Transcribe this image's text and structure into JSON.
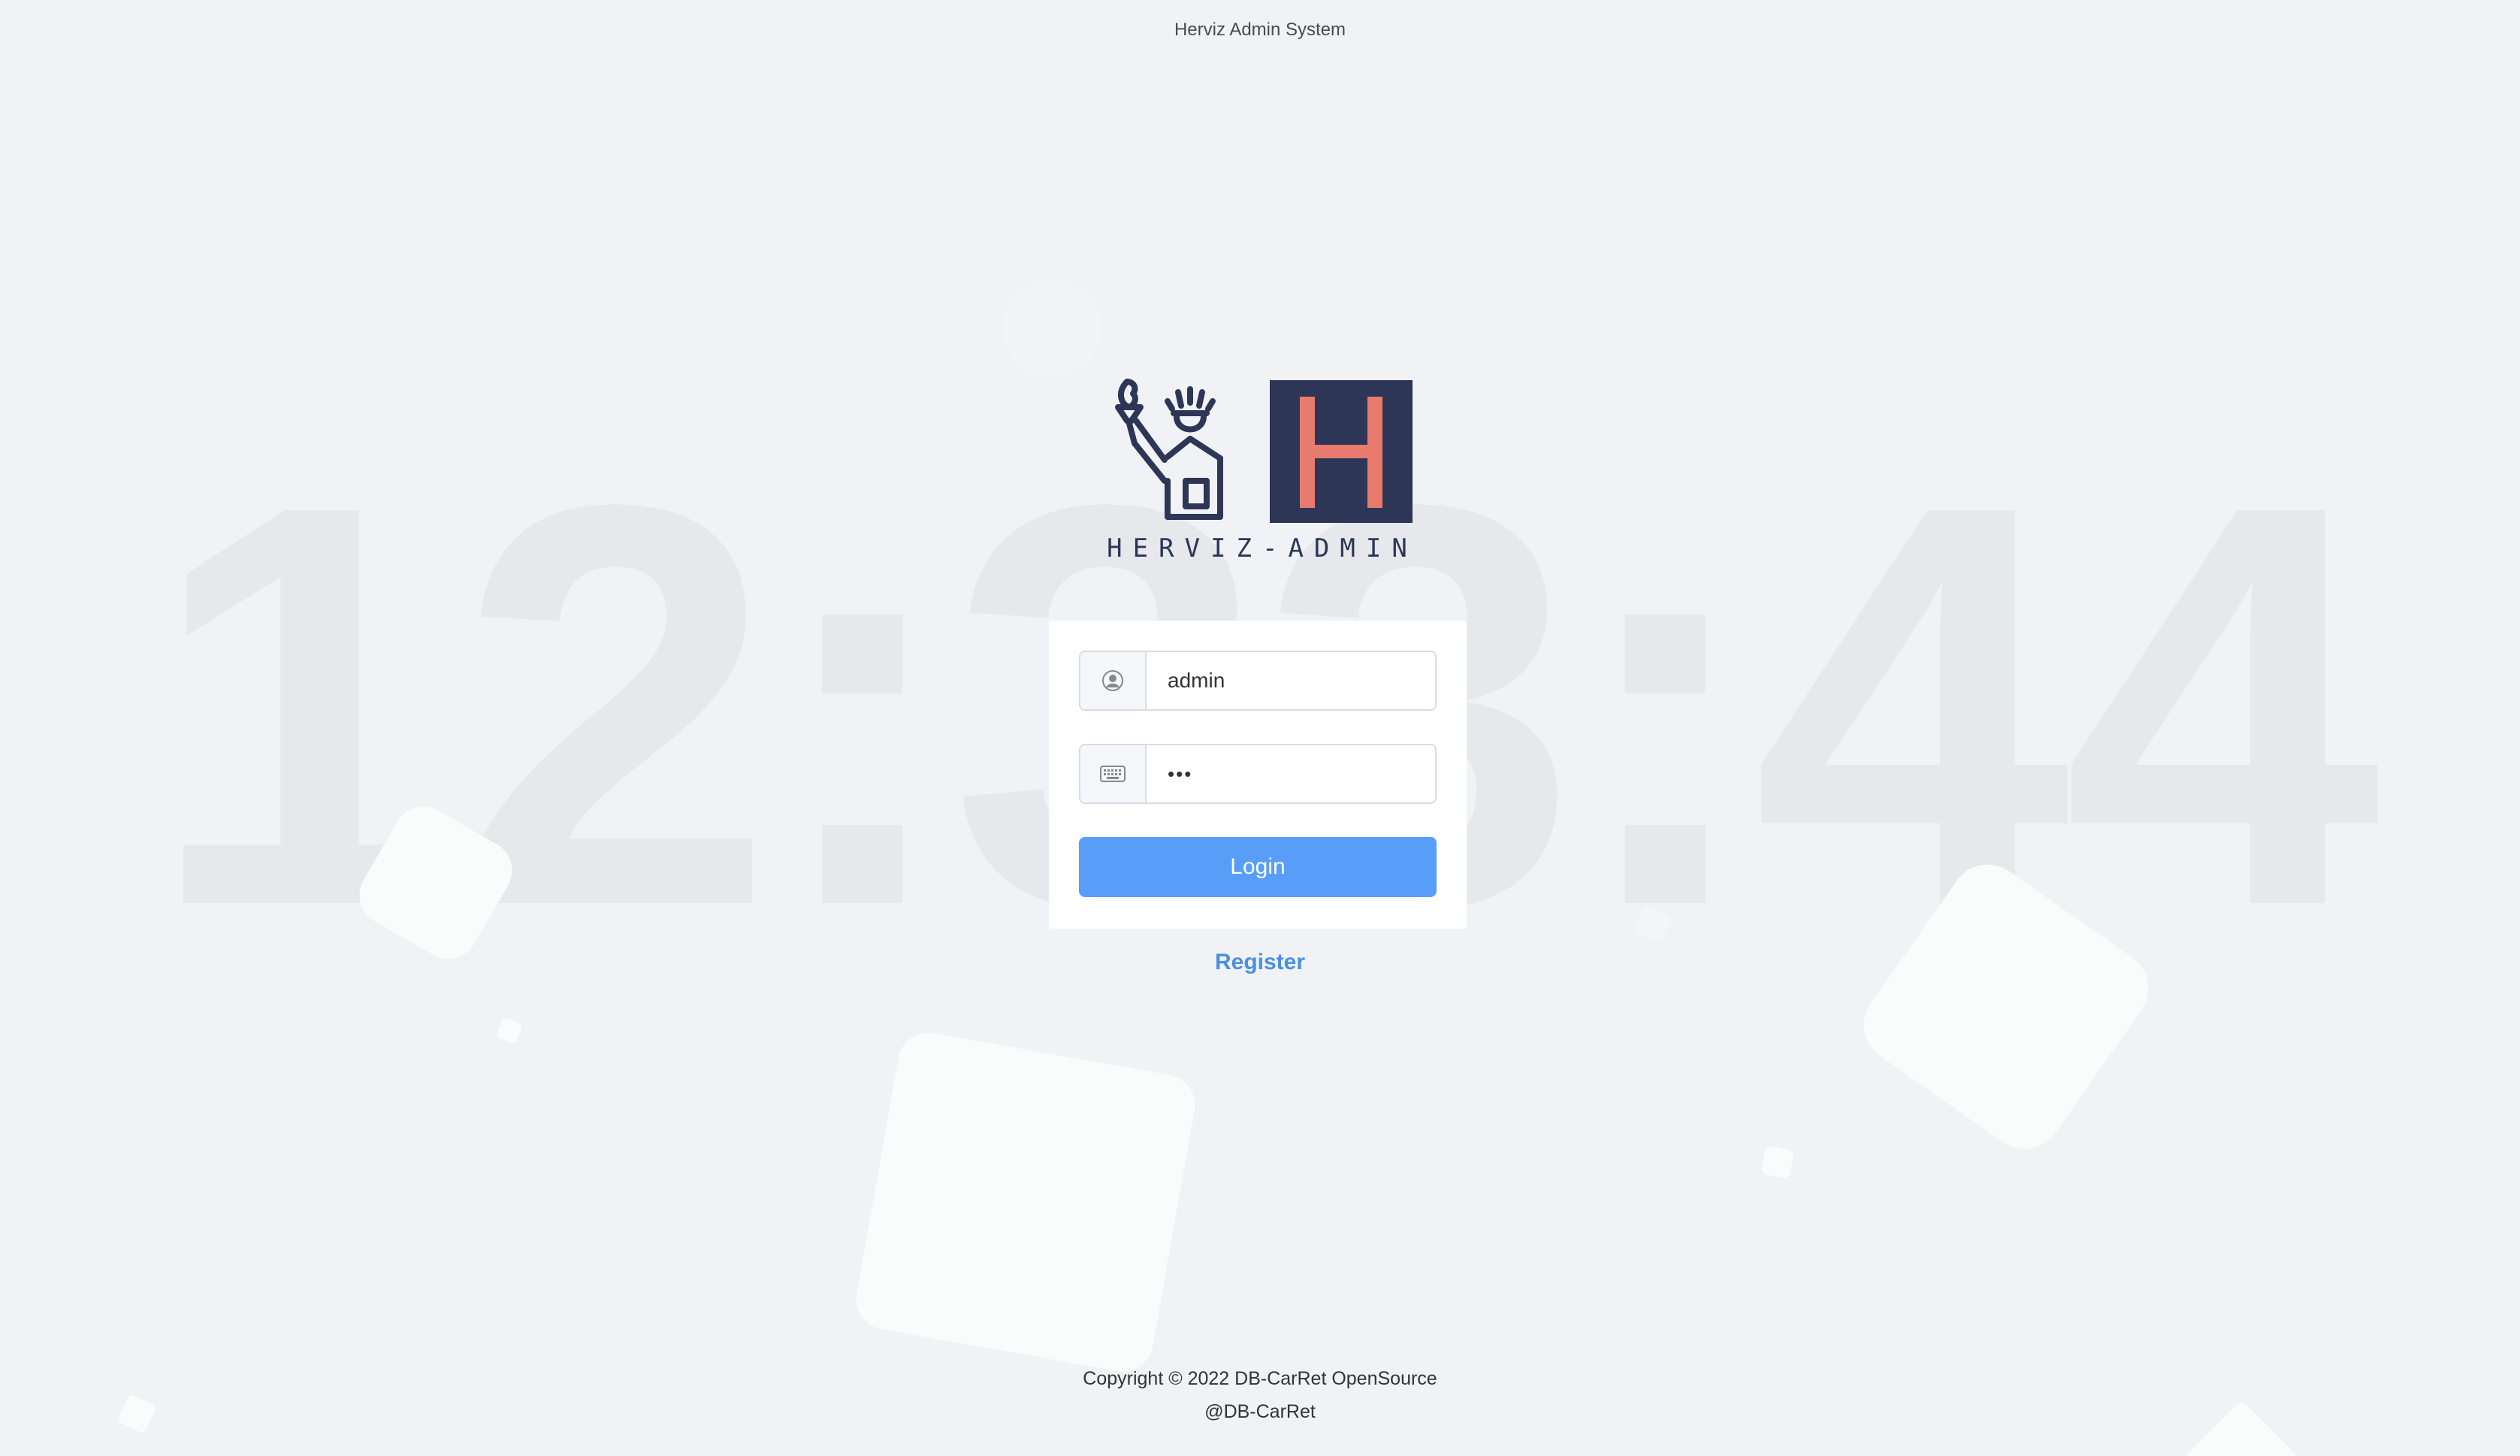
{
  "app": {
    "title": "Herviz Admin System"
  },
  "background": {
    "clock_text": "12:33:44"
  },
  "logo": {
    "text": "HERVIZ-ADMIN",
    "letter": "H",
    "box_color": "#2e3657",
    "letter_color": "#e87a6e"
  },
  "login_form": {
    "username": {
      "icon": "user-circle-icon",
      "value": "admin"
    },
    "password": {
      "icon": "keyboard-icon",
      "value": "•••"
    },
    "login_label": "Login",
    "register_label": "Register"
  },
  "footer": {
    "copyright": "Copyright © 2022 DB-CarRet OpenSource",
    "handle": "@DB-CarRet"
  },
  "colors": {
    "primary_button": "#589ef8",
    "link": "#4a90e2",
    "background": "#f0f2f5"
  }
}
